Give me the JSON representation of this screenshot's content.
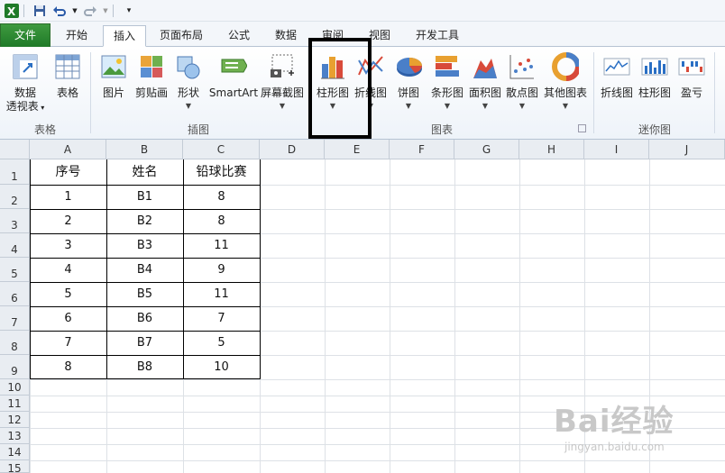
{
  "ribbon_tabs": [
    "文件",
    "开始",
    "插入",
    "页面布局",
    "公式",
    "数据",
    "审阅",
    "视图",
    "开发工具"
  ],
  "active_tab": "插入",
  "groups": {
    "table": {
      "label": "表格",
      "commands": {
        "pivot_line1": "数据",
        "pivot_line2": "透视表",
        "table": "表格"
      }
    },
    "illustrations": {
      "label": "插图",
      "commands": {
        "picture": "图片",
        "clipart": "剪贴画",
        "shapes": "形状",
        "smartart": "SmartArt",
        "screenshot": "屏幕截图"
      }
    },
    "charts": {
      "label": "图表",
      "commands": {
        "column": "柱形图",
        "line": "折线图",
        "pie": "饼图",
        "bar": "条形图",
        "area": "面积图",
        "scatter": "散点图",
        "other": "其他图表"
      }
    },
    "sparklines": {
      "label": "迷你图",
      "commands": {
        "line": "折线图",
        "column": "柱形图",
        "winloss": "盈亏"
      }
    }
  },
  "columns": [
    "A",
    "B",
    "C",
    "D",
    "E",
    "F",
    "G",
    "H",
    "I",
    "J"
  ],
  "rows": [
    "1",
    "2",
    "3",
    "4",
    "5",
    "6",
    "7",
    "8",
    "9",
    "10",
    "11",
    "12",
    "13",
    "14",
    "15"
  ],
  "table": {
    "headers": [
      "序号",
      "姓名",
      "铅球比赛"
    ],
    "data": [
      [
        "1",
        "B1",
        "8"
      ],
      [
        "2",
        "B2",
        "8"
      ],
      [
        "3",
        "B3",
        "11"
      ],
      [
        "4",
        "B4",
        "9"
      ],
      [
        "5",
        "B5",
        "11"
      ],
      [
        "6",
        "B6",
        "7"
      ],
      [
        "7",
        "B7",
        "5"
      ],
      [
        "8",
        "B8",
        "10"
      ]
    ]
  },
  "watermark": {
    "brand": "Bai经验",
    "url": "jingyan.baidu.com"
  },
  "colors": {
    "file_tab": "#2e8b34",
    "accent": "#b6c3d3"
  }
}
